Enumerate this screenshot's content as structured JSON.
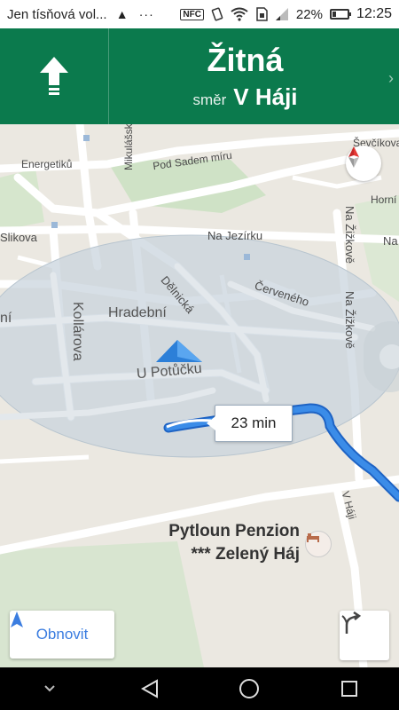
{
  "status_bar": {
    "notification_text": "Jen tísňová vol...",
    "warning_icon": "warning-icon",
    "overflow_icon": "more-dots-icon",
    "nfc_label": "NFC",
    "battery_percent": "22%",
    "battery_level": 0.22,
    "time": "12:25"
  },
  "navigation": {
    "maneuver_icon": "straight-arrow-icon",
    "street_name": "Žitná",
    "direction_prefix": "směr",
    "direction_target": "V Háji"
  },
  "map": {
    "street_labels": {
      "energetiku": "Energetiků",
      "mikulasska": "Mikulášská",
      "pod_sadem_miru": "Pod Sadem míru",
      "sevcikova": "Ševčíkova",
      "horni": "Horní",
      "slikova": "Slikova",
      "na_jezirku": "Na Jezírku",
      "na_zizkove_1": "Na Žižkově",
      "na_zizkove_2": "Na Žižkově",
      "na": "Na",
      "delnicka": "Dělnická",
      "cerveneho": "Červeného",
      "kollarova": "Kollárova",
      "hradebni": "Hradební",
      "u_potucku": "U Potůčku",
      "ni": "ní",
      "v_haji": "V Háji"
    },
    "eta": "23 min",
    "poi": {
      "line1": "Pytloun Penzion",
      "line2": "*** Zelený Háj",
      "icon": "hotel-bed-icon"
    },
    "route_color": "#2a7de1",
    "accuracy_fill": "#c8d3dc",
    "position_marker_color": "#3d8ee6"
  },
  "controls": {
    "recenter_label": "Obnovit",
    "recenter_icon": "navigation-arrow-icon",
    "routes_icon": "alternate-routes-icon",
    "compass_icon": "compass-icon"
  },
  "system_nav": {
    "hide_icon": "chevron-down-icon",
    "back_icon": "back-triangle-icon",
    "home_icon": "home-circle-icon",
    "recents_icon": "recents-square-icon"
  }
}
